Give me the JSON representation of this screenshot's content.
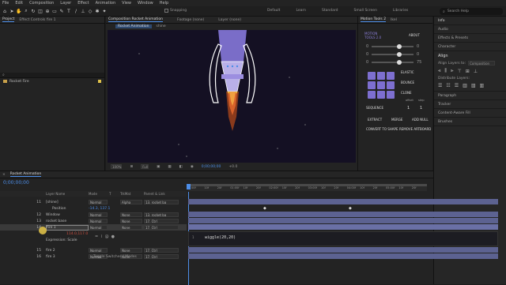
{
  "menu": [
    "File",
    "Edit",
    "Composition",
    "Layer",
    "Effect",
    "Animation",
    "View",
    "Window",
    "Help"
  ],
  "toolbar": {
    "snapping": "Snapping",
    "workspaces": [
      "Default",
      "Learn",
      "Standard",
      "Small Screen",
      "Libraries"
    ],
    "search_placeholder": "Search Help"
  },
  "left_panel": {
    "tabs": [
      "Project",
      "Effect Controls fire 1"
    ],
    "item": "Rocket Fire"
  },
  "viewer": {
    "tabs": [
      "Composition Rocket Animation",
      "Footage (none)",
      "Layer (none)"
    ],
    "breadcrumbs": [
      "Rocket Animation",
      "shine"
    ],
    "zoom": "100%",
    "quality": "Full",
    "timecode": "0;00;00;00",
    "exposure": "+0.0"
  },
  "motion_tools": {
    "tabs": [
      "Motion Tools 2",
      "Ikel"
    ],
    "title": "MOTION TOOLS 2.0",
    "about": "ABOUT",
    "sliders": [
      {
        "label": "0",
        "value": "0"
      },
      {
        "label": "0",
        "value": "0"
      },
      {
        "label": "0",
        "value": "75"
      }
    ],
    "elastic": "ELASTIC",
    "bounce": "BOUNCE",
    "clone": "CLONE",
    "sequence": "SEQUENCE",
    "offset_label": "offset",
    "step_label": "step",
    "offset": "1",
    "step": "1",
    "extract": "EXTRACT",
    "merge": "MERGE",
    "add_null": "ADD NULL",
    "convert": "CONVERT TO SHAPE",
    "remove": "REMOVE ARTBOARD"
  },
  "right_panels": {
    "top": [
      "Info",
      "Audio",
      "Effects & Presets",
      "Character"
    ],
    "align": {
      "title": "Align",
      "align_to_label": "Align Layers to:",
      "align_to": "Composition",
      "distribute": "Distribute Layers:"
    },
    "lower": [
      "Paragraph",
      "Tracker",
      "Content-Aware Fill",
      "Brushes"
    ]
  },
  "timeline": {
    "tab": "Rocket Animation",
    "timecode": "0;00;00;00",
    "columns": [
      "Layer Name",
      "Mode",
      "T",
      "TrkMat",
      "Parent & Link"
    ],
    "ticks": [
      "00f",
      "10f",
      "20f",
      "01:00f",
      "10f",
      "20f",
      "02:00f",
      "10f",
      "20f",
      "03:00f",
      "10f",
      "20f",
      "04:00f",
      "10f",
      "20f",
      "05:00f",
      "10f",
      "20f"
    ],
    "layers": [
      {
        "num": "11",
        "name": "[shine]",
        "mode": "Normal",
        "trkmat": "Alpha",
        "parent": "13. rocket ba"
      },
      {
        "num": "",
        "name": "Position",
        "mode": "-14.3, 137.1",
        "trkmat": "",
        "parent": ""
      },
      {
        "num": "12",
        "name": "Window",
        "mode": "Normal",
        "trkmat": "None",
        "parent": "13. rocket ba"
      },
      {
        "num": "13",
        "name": "rocket base",
        "mode": "Normal",
        "trkmat": "None",
        "parent": "17. Ctrl"
      },
      {
        "num": "14",
        "name": "fire 1",
        "mode": "Normal",
        "trkmat": "None",
        "parent": "17. Ctrl"
      }
    ],
    "expression_label": "Expression: Scale",
    "expression": "wiggle(20,20)",
    "scale_value": "114.0,117.0",
    "layers2": [
      {
        "num": "15",
        "name": "fire 2",
        "mode": "Normal",
        "trkmat": "None",
        "parent": "17. Ctrl"
      },
      {
        "num": "16",
        "name": "fire 3",
        "mode": "Normal",
        "trkmat": "None",
        "parent": "17. Ctrl"
      }
    ],
    "footer": "Toggle Switches / Modes"
  },
  "colors": {
    "accent": "#4d8ee8",
    "layer_bar": "#5c6291",
    "purple": "#7d6fd0",
    "fire": "#e8923a"
  }
}
